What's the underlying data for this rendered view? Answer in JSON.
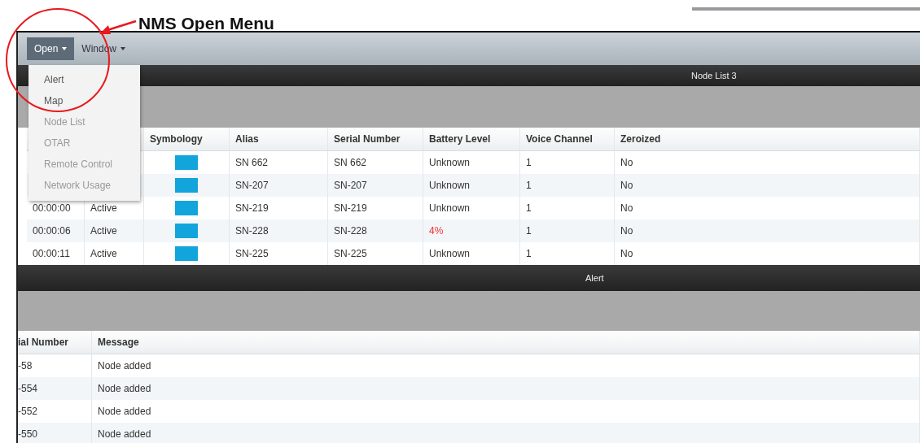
{
  "annotation": {
    "text": "NMS Open Menu"
  },
  "menubar": [
    {
      "label": "Open",
      "selected": true
    },
    {
      "label": "Window",
      "selected": false
    }
  ],
  "open_menu": {
    "items": [
      {
        "label": "Alert",
        "disabled": false
      },
      {
        "label": "Map",
        "disabled": false
      },
      {
        "label": "Node List",
        "disabled": true
      },
      {
        "label": "OTAR",
        "disabled": true
      },
      {
        "label": "Remote Control",
        "disabled": true
      },
      {
        "label": "Network Usage",
        "disabled": true
      }
    ]
  },
  "node_list": {
    "title": "Node List 3",
    "columns": [
      "Symbology",
      "Alias",
      "Serial Number",
      "Battery Level",
      "Voice Channel",
      "Zeroized"
    ],
    "rows": [
      {
        "alias": "SN 662",
        "serial": "SN 662",
        "battery": "Unknown",
        "battery_low": false,
        "voice": "1",
        "zeroized": "No",
        "color": "#12a5dc"
      },
      {
        "alias": "SN-207",
        "serial": "SN-207",
        "battery": "Unknown",
        "battery_low": false,
        "voice": "1",
        "zeroized": "No",
        "color": "#12a5dc"
      },
      {
        "time": "00:00:00",
        "state": "Active",
        "alias": "SN-219",
        "serial": "SN-219",
        "battery": "Unknown",
        "battery_low": false,
        "voice": "1",
        "zeroized": "No",
        "color": "#12a5dc"
      },
      {
        "time": "00:00:06",
        "state": "Active",
        "alias": "SN-228",
        "serial": "SN-228",
        "battery": "4%",
        "battery_low": true,
        "voice": "1",
        "zeroized": "No",
        "color": "#12a5dc"
      },
      {
        "time": "00:00:11",
        "state": "Active",
        "alias": "SN-225",
        "serial": "SN-225",
        "battery": "Unknown",
        "battery_low": false,
        "voice": "1",
        "zeroized": "No",
        "color": "#12a5dc"
      }
    ]
  },
  "alert": {
    "title": "Alert",
    "columns": [
      "ial Number",
      "Message"
    ],
    "rows": [
      {
        "serial": "-58",
        "message": "Node added"
      },
      {
        "serial": "-554",
        "message": "Node added"
      },
      {
        "serial": "-552",
        "message": "Node added"
      },
      {
        "serial": "-550",
        "message": "Node added"
      }
    ]
  }
}
